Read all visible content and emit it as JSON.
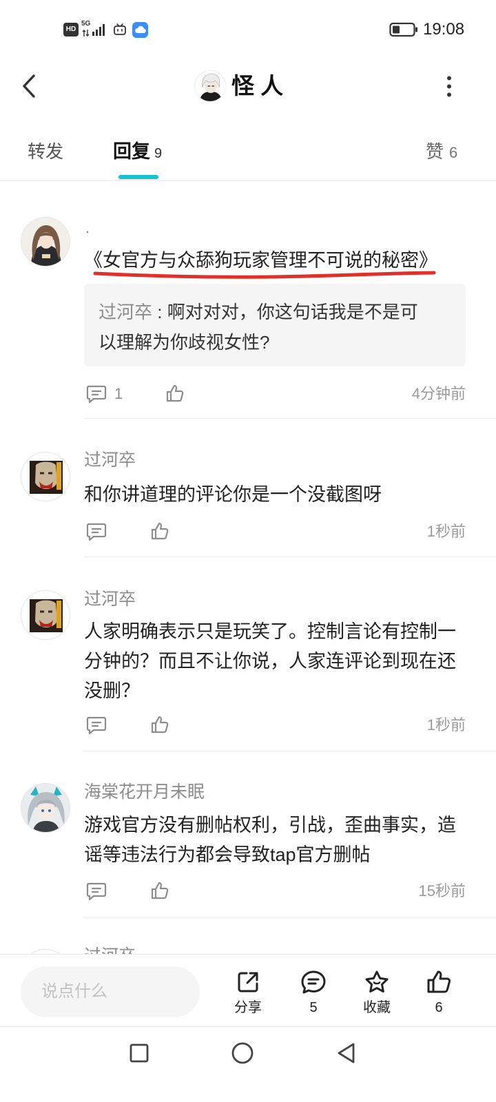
{
  "status_bar": {
    "hd_badge": "HD",
    "network": "5G",
    "time": "19:08",
    "icons": [
      "hd-icon",
      "signal-icon",
      "tv-app-icon",
      "cloud-app-icon",
      "battery-icon"
    ]
  },
  "header": {
    "title": "怪 人",
    "icons": {
      "back": "chevron-left-icon",
      "more": "more-vertical-icon"
    }
  },
  "tabs": [
    {
      "label": "转发"
    },
    {
      "label": "回复",
      "count": "9",
      "active": true
    },
    {
      "label": "赞",
      "count": "6"
    }
  ],
  "comments": [
    {
      "author": ".",
      "text": "《女官方与众舔狗玩家管理不可说的秘密》",
      "quote": {
        "author": "过河卒",
        "separator": " : ",
        "text": "啊对对对，你这句话我是不是可以理解为你歧视女性?"
      },
      "reply_count": "1",
      "time": "4分钟前"
    },
    {
      "author": "过河卒",
      "text": "和你讲道理的评论你是一个没截图呀",
      "time": "1秒前"
    },
    {
      "author": "过河卒",
      "text": "人家明确表示只是玩笑了。控制言论有控制一分钟的？而且不让你说，人家连评论到现在还没删？",
      "time": "1秒前"
    },
    {
      "author": "海棠花开月未眠",
      "text": "游戏官方没有删帖权利，引战，歪曲事实，造谣等违法行为都会导致tap官方删帖",
      "time": "15秒前"
    },
    {
      "author": "过河卒"
    }
  ],
  "bottom_bar": {
    "placeholder": "说点什么",
    "share_label": "分享",
    "comment_count": "5",
    "favorite_label": "收藏",
    "like_count": "6",
    "icons": [
      "share-icon",
      "comment-icon",
      "star-icon",
      "thumbs-up-icon"
    ]
  },
  "nav_bar": {
    "icons": [
      "recent-apps-icon",
      "home-icon",
      "back-triangle-icon"
    ]
  },
  "colors": {
    "accent": "#16c2cb",
    "annotation": "#e0302a",
    "text": "#222222",
    "secondary": "#8c8c8c",
    "quote_background": "#f5f5f5",
    "cloud_app": "#3a8ef6"
  }
}
